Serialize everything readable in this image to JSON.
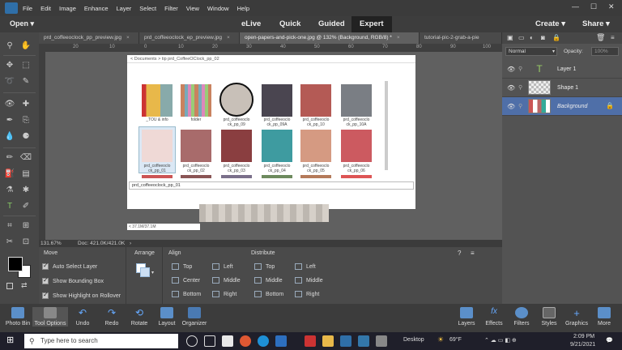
{
  "menubar": {
    "items": [
      "File",
      "Edit",
      "Image",
      "Enhance",
      "Layer",
      "Select",
      "Filter",
      "View",
      "Window",
      "Help"
    ]
  },
  "modebar": {
    "open": "Open",
    "modes": [
      "eLive",
      "Quick",
      "Guided",
      "Expert"
    ],
    "active": "Expert",
    "create": "Create",
    "share": "Share"
  },
  "tabs": [
    {
      "label": "prd_coffeeoclock_pp_preview.jpg",
      "active": false
    },
    {
      "label": "prd_coffeeoclock_ep_preview.jpg",
      "active": false
    },
    {
      "label": "open-papers-and-pick-one.jpg @ 132% (Background, RGB/8) *",
      "active": true
    },
    {
      "label": "tutorial-pic-2-grab-a-pie",
      "active": false
    }
  ],
  "ruler": {
    "ticks": [
      "20",
      "10",
      "0",
      "10",
      "20",
      "30",
      "40",
      "50",
      "60",
      "70",
      "80",
      "90",
      "100"
    ]
  },
  "doc": {
    "path": "< Documents  >  tip prd_CoffeeOClock_pp_02",
    "row1": [
      {
        "cap": "_TOU & info",
        "color": "#e8b84a"
      },
      {
        "cap": "folder",
        "color": "#c9825f"
      },
      {
        "cap": "prd_coffeeoclo ck_pp_09",
        "color": "#c8c0b8"
      },
      {
        "cap": "prd_coffeeoclo ck_pp_09A",
        "color": "#4a4550"
      },
      {
        "cap": "prd_coffeeoclo ck_pp_10",
        "color": "#b45a55"
      },
      {
        "cap": "prd_coffeeoclo ck_pp_10A",
        "color": "#7a7e84"
      }
    ],
    "row2": [
      {
        "cap": "prd_coffeeoclo ck_pp_01",
        "color": "#efd9d6"
      },
      {
        "cap": "prd_coffeeoclo ck_pp_02",
        "color": "#a86b6b"
      },
      {
        "cap": "prd_coffeeoclo ck_pp_03",
        "color": "#8a3e40"
      },
      {
        "cap": "prd_coffeeoclo ck_pp_04",
        "color": "#3e9ba0"
      },
      {
        "cap": "prd_coffeeoclo ck_pp_05",
        "color": "#d59a82"
      },
      {
        "cap": "prd_coffeeoclo ck_pp_06",
        "color": "#cc5a60"
      }
    ],
    "filename": "prd_coffeeoclock_pp_01",
    "status_left": "< 37.1M/37.1M"
  },
  "zoomrow": {
    "zoom": "131.67%",
    "doc": "Doc: 421.0K/421.0K"
  },
  "options": {
    "move": "Move",
    "auto_select": "Auto Select Layer",
    "bounding": "Show Bounding Box",
    "highlight": "Show Highlight on Rollover",
    "arrange": "Arrange",
    "align": "Align",
    "align_items": [
      "Top",
      "Center",
      "Bottom",
      "Left",
      "Middle",
      "Right"
    ],
    "distribute": "Distribute",
    "dist_items": [
      "Top",
      "Middle",
      "Bottom",
      "Left",
      "Middle",
      "Right"
    ]
  },
  "layers": {
    "blend": "Normal",
    "opacity_label": "Opacity:",
    "opacity": "100%",
    "items": [
      {
        "name": "Layer 1",
        "active": false
      },
      {
        "name": "Shape 1",
        "active": false
      },
      {
        "name": "Background",
        "active": true
      }
    ]
  },
  "taskpanel": {
    "left": [
      "Photo Bin",
      "Tool Options",
      "Undo",
      "Redo",
      "Rotate",
      "Layout",
      "Organizer"
    ],
    "right": [
      "Layers",
      "Effects",
      "Filters",
      "Styles",
      "Graphics",
      "More"
    ]
  },
  "taskbar": {
    "search": "Type here to search",
    "desktop": "Desktop",
    "weather": "69°F",
    "time": "2:09 PM",
    "date": "9/21/2021"
  },
  "colors": {
    "accent": "#4f6fa8",
    "panel": "#535353"
  }
}
